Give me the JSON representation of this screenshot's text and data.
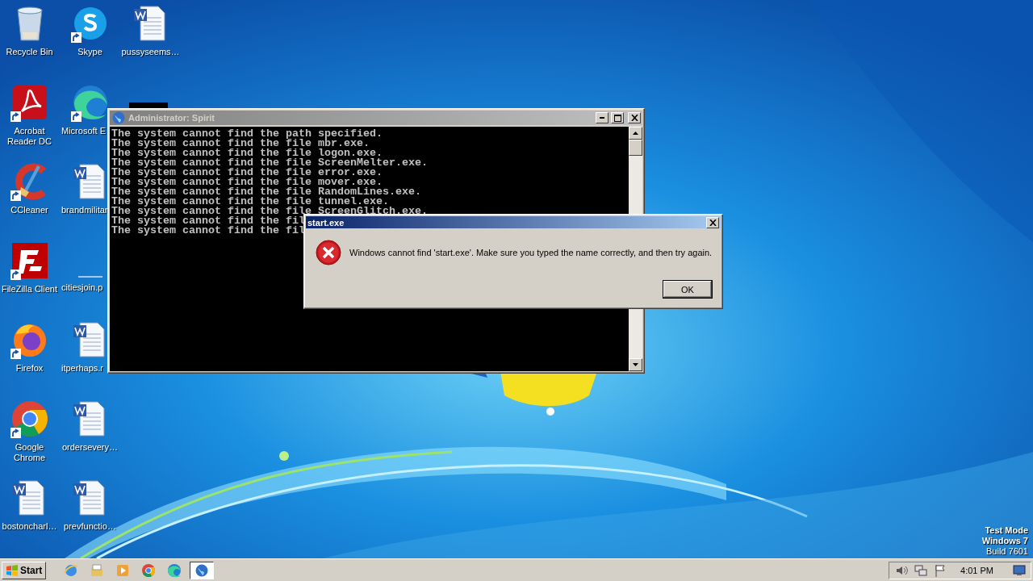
{
  "desktop": {
    "icons": [
      {
        "kind": "recycle-bin",
        "label": "Recycle Bin",
        "shortcut": false,
        "cut": false
      },
      {
        "kind": "acrobat",
        "label": "Acrobat Reader DC",
        "shortcut": true,
        "cut": false
      },
      {
        "kind": "ccleaner",
        "label": "CCleaner",
        "shortcut": true,
        "cut": false
      },
      {
        "kind": "filezilla",
        "label": "FileZilla Client",
        "shortcut": true,
        "cut": false
      },
      {
        "kind": "firefox",
        "label": "Firefox",
        "shortcut": true,
        "cut": false
      },
      {
        "kind": "chrome",
        "label": "Google Chrome",
        "shortcut": true,
        "cut": false
      },
      {
        "kind": "word",
        "label": "bostoncharl…",
        "shortcut": false,
        "cut": false
      },
      {
        "kind": "skype",
        "label": "Skype",
        "shortcut": true,
        "cut": false
      },
      {
        "kind": "edge",
        "label": "Microsoft E",
        "shortcut": true,
        "cut": true
      },
      {
        "kind": "word",
        "label": "brandmilitar",
        "shortcut": false,
        "cut": true
      },
      {
        "kind": "blank",
        "label": "citiesjoin.p",
        "shortcut": false,
        "cut": true
      },
      {
        "kind": "word",
        "label": "itperhaps.r",
        "shortcut": false,
        "cut": true
      },
      {
        "kind": "word",
        "label": "ordersevery…",
        "shortcut": false,
        "cut": false
      },
      {
        "kind": "word",
        "label": "prevfunctio…",
        "shortcut": false,
        "cut": false
      },
      {
        "kind": "word",
        "label": "pussyseems…",
        "shortcut": false,
        "cut": false
      }
    ]
  },
  "console_window": {
    "title": "Administrator: Spirit",
    "active": false,
    "lines": [
      "The system cannot find the path specified.",
      "The system cannot find the file mbr.exe.",
      "The system cannot find the file logon.exe.",
      "The system cannot find the file ScreenMelter.exe.",
      "The system cannot find the file error.exe.",
      "The system cannot find the file mover.exe.",
      "The system cannot find the file RandomLines.exe.",
      "The system cannot find the file tunnel.exe.",
      "The system cannot find the file ScreenGlitch.exe.",
      "The system cannot find the fil",
      "The system cannot find the fil"
    ]
  },
  "error_dialog": {
    "title": "start.exe",
    "active": true,
    "message": "Windows cannot find 'start.exe'. Make sure you typed the name correctly, and then try again.",
    "button": "OK"
  },
  "taskbar": {
    "start": "Start",
    "quick_launch": [
      {
        "kind": "ie"
      },
      {
        "kind": "folder"
      },
      {
        "kind": "media"
      },
      {
        "kind": "chrome"
      },
      {
        "kind": "edge"
      }
    ],
    "tasks": [
      {
        "kind": "globe",
        "selected": true
      }
    ],
    "tray": [
      {
        "kind": "speaker"
      },
      {
        "kind": "network"
      },
      {
        "kind": "flag"
      }
    ],
    "clock": "4:01 PM"
  },
  "os_notice": [
    "Test Mode",
    "Windows 7",
    "Build 7601"
  ]
}
